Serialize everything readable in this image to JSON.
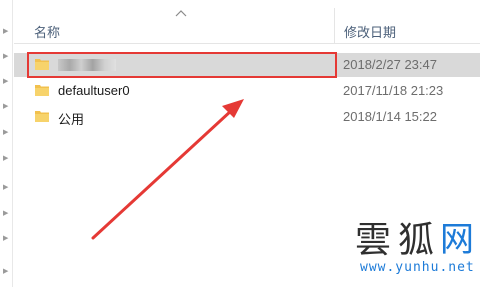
{
  "columns": {
    "name": "名称",
    "date_modified": "修改日期"
  },
  "rows": [
    {
      "name": "",
      "date": "2018/2/27 23:47",
      "selected": true,
      "name_blurred": true
    },
    {
      "name": "defaultuser0",
      "date": "2017/11/18 21:23",
      "selected": false
    },
    {
      "name": "公用",
      "date": "2018/1/14 15:22",
      "selected": false
    }
  ],
  "watermark": {
    "chars": [
      "雲",
      "狐",
      "网"
    ],
    "url": "www.yunhu.net"
  },
  "colors": {
    "folder": "#f2c14e",
    "highlight": "#e53935",
    "arrow": "#e53935",
    "selected_row": "#d9d9d9",
    "watermark_accent": "#1d7bd8"
  },
  "icons": [
    "sort-up-icon",
    "folder-icon",
    "chevron-right-icon"
  ]
}
